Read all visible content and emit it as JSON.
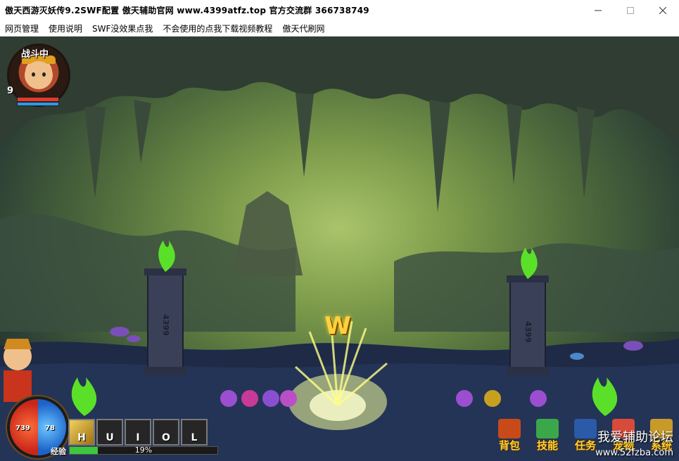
{
  "window": {
    "title": "傲天西游灭妖传9.2SWF配置 傲天辅助官网 www.4399atfz.top  官方交流群 366738749",
    "minimize_icon": "minimize-icon",
    "maximize_icon": "maximize-icon",
    "close_icon": "close-icon"
  },
  "menu": {
    "items": [
      {
        "label": "网页管理"
      },
      {
        "label": "使用说明"
      },
      {
        "label": "SWF没效果点我"
      },
      {
        "label": "不会使用的点我下载视频教程"
      },
      {
        "label": "傲天代刷网"
      }
    ]
  },
  "hud": {
    "status": "战斗中",
    "level": "9",
    "hp_value": "739",
    "mp_value": "78",
    "exp_label": "经验",
    "exp_percent": "19%",
    "exp_fraction": 0.19
  },
  "skills": {
    "keys": [
      "H",
      "U",
      "I",
      "O",
      "L"
    ]
  },
  "prompt": {
    "key": "W"
  },
  "pillars": {
    "label": "4399"
  },
  "buttons": {
    "bag": "背包",
    "skill": "技能",
    "quest": "任务",
    "pet": "宠物",
    "system": "系统"
  },
  "watermark": {
    "text": "我爱辅助论坛",
    "url": "www.52fzba.com"
  },
  "colors": {
    "cave_glow": "#a9c46a",
    "hotkey": "#ffd23a",
    "hp": "#e83a2a",
    "mp": "#2a9be8",
    "exp": "#3cc83c"
  }
}
